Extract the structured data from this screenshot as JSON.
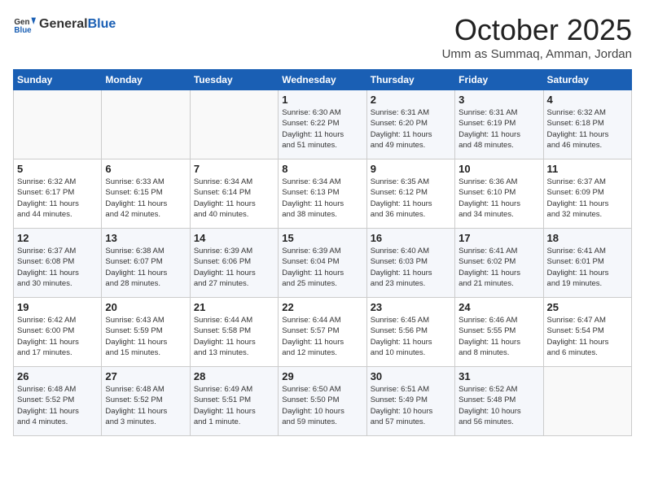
{
  "header": {
    "logo_general": "General",
    "logo_blue": "Blue",
    "month_title": "October 2025",
    "location": "Umm as Summaq, Amman, Jordan"
  },
  "days_of_week": [
    "Sunday",
    "Monday",
    "Tuesday",
    "Wednesday",
    "Thursday",
    "Friday",
    "Saturday"
  ],
  "weeks": [
    [
      {
        "day": "",
        "info": ""
      },
      {
        "day": "",
        "info": ""
      },
      {
        "day": "",
        "info": ""
      },
      {
        "day": "1",
        "info": "Sunrise: 6:30 AM\nSunset: 6:22 PM\nDaylight: 11 hours\nand 51 minutes."
      },
      {
        "day": "2",
        "info": "Sunrise: 6:31 AM\nSunset: 6:20 PM\nDaylight: 11 hours\nand 49 minutes."
      },
      {
        "day": "3",
        "info": "Sunrise: 6:31 AM\nSunset: 6:19 PM\nDaylight: 11 hours\nand 48 minutes."
      },
      {
        "day": "4",
        "info": "Sunrise: 6:32 AM\nSunset: 6:18 PM\nDaylight: 11 hours\nand 46 minutes."
      }
    ],
    [
      {
        "day": "5",
        "info": "Sunrise: 6:32 AM\nSunset: 6:17 PM\nDaylight: 11 hours\nand 44 minutes."
      },
      {
        "day": "6",
        "info": "Sunrise: 6:33 AM\nSunset: 6:15 PM\nDaylight: 11 hours\nand 42 minutes."
      },
      {
        "day": "7",
        "info": "Sunrise: 6:34 AM\nSunset: 6:14 PM\nDaylight: 11 hours\nand 40 minutes."
      },
      {
        "day": "8",
        "info": "Sunrise: 6:34 AM\nSunset: 6:13 PM\nDaylight: 11 hours\nand 38 minutes."
      },
      {
        "day": "9",
        "info": "Sunrise: 6:35 AM\nSunset: 6:12 PM\nDaylight: 11 hours\nand 36 minutes."
      },
      {
        "day": "10",
        "info": "Sunrise: 6:36 AM\nSunset: 6:10 PM\nDaylight: 11 hours\nand 34 minutes."
      },
      {
        "day": "11",
        "info": "Sunrise: 6:37 AM\nSunset: 6:09 PM\nDaylight: 11 hours\nand 32 minutes."
      }
    ],
    [
      {
        "day": "12",
        "info": "Sunrise: 6:37 AM\nSunset: 6:08 PM\nDaylight: 11 hours\nand 30 minutes."
      },
      {
        "day": "13",
        "info": "Sunrise: 6:38 AM\nSunset: 6:07 PM\nDaylight: 11 hours\nand 28 minutes."
      },
      {
        "day": "14",
        "info": "Sunrise: 6:39 AM\nSunset: 6:06 PM\nDaylight: 11 hours\nand 27 minutes."
      },
      {
        "day": "15",
        "info": "Sunrise: 6:39 AM\nSunset: 6:04 PM\nDaylight: 11 hours\nand 25 minutes."
      },
      {
        "day": "16",
        "info": "Sunrise: 6:40 AM\nSunset: 6:03 PM\nDaylight: 11 hours\nand 23 minutes."
      },
      {
        "day": "17",
        "info": "Sunrise: 6:41 AM\nSunset: 6:02 PM\nDaylight: 11 hours\nand 21 minutes."
      },
      {
        "day": "18",
        "info": "Sunrise: 6:41 AM\nSunset: 6:01 PM\nDaylight: 11 hours\nand 19 minutes."
      }
    ],
    [
      {
        "day": "19",
        "info": "Sunrise: 6:42 AM\nSunset: 6:00 PM\nDaylight: 11 hours\nand 17 minutes."
      },
      {
        "day": "20",
        "info": "Sunrise: 6:43 AM\nSunset: 5:59 PM\nDaylight: 11 hours\nand 15 minutes."
      },
      {
        "day": "21",
        "info": "Sunrise: 6:44 AM\nSunset: 5:58 PM\nDaylight: 11 hours\nand 13 minutes."
      },
      {
        "day": "22",
        "info": "Sunrise: 6:44 AM\nSunset: 5:57 PM\nDaylight: 11 hours\nand 12 minutes."
      },
      {
        "day": "23",
        "info": "Sunrise: 6:45 AM\nSunset: 5:56 PM\nDaylight: 11 hours\nand 10 minutes."
      },
      {
        "day": "24",
        "info": "Sunrise: 6:46 AM\nSunset: 5:55 PM\nDaylight: 11 hours\nand 8 minutes."
      },
      {
        "day": "25",
        "info": "Sunrise: 6:47 AM\nSunset: 5:54 PM\nDaylight: 11 hours\nand 6 minutes."
      }
    ],
    [
      {
        "day": "26",
        "info": "Sunrise: 6:48 AM\nSunset: 5:52 PM\nDaylight: 11 hours\nand 4 minutes."
      },
      {
        "day": "27",
        "info": "Sunrise: 6:48 AM\nSunset: 5:52 PM\nDaylight: 11 hours\nand 3 minutes."
      },
      {
        "day": "28",
        "info": "Sunrise: 6:49 AM\nSunset: 5:51 PM\nDaylight: 11 hours\nand 1 minute."
      },
      {
        "day": "29",
        "info": "Sunrise: 6:50 AM\nSunset: 5:50 PM\nDaylight: 10 hours\nand 59 minutes."
      },
      {
        "day": "30",
        "info": "Sunrise: 6:51 AM\nSunset: 5:49 PM\nDaylight: 10 hours\nand 57 minutes."
      },
      {
        "day": "31",
        "info": "Sunrise: 6:52 AM\nSunset: 5:48 PM\nDaylight: 10 hours\nand 56 minutes."
      },
      {
        "day": "",
        "info": ""
      }
    ]
  ]
}
